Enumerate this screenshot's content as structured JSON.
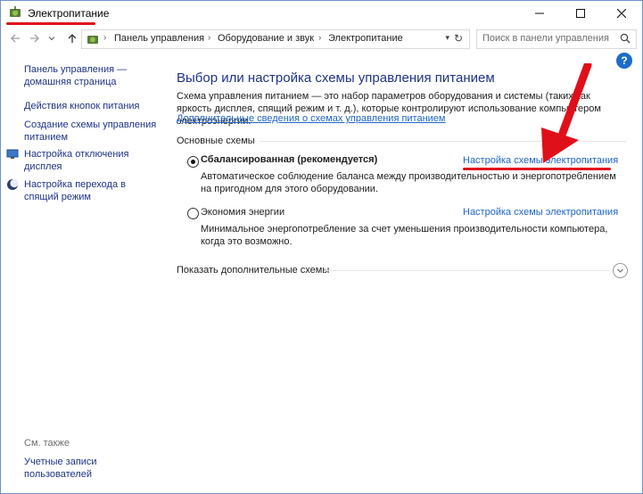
{
  "window": {
    "title": "Электропитание",
    "icon": "power-options-icon",
    "controls": {
      "minimize": "minimize-icon",
      "maximize": "maximize-icon",
      "close": "close-icon"
    }
  },
  "nav": {
    "back": "arrow-left-icon",
    "forward": "arrow-right-icon",
    "recent": "chevron-down-icon",
    "up": "arrow-up-icon",
    "breadcrumbs": [
      "Панель управления",
      "Оборудование и звук",
      "Электропитание"
    ],
    "search_placeholder": "Поиск в панели управления"
  },
  "sidebar": {
    "home": "Панель управления —\nдомашняя страница",
    "items": [
      {
        "label": "Действия кнопок питания",
        "icon": ""
      },
      {
        "label": "Создание схемы управления\nпитанием",
        "icon": ""
      },
      {
        "label": "Настройка отключения\nдисплея",
        "icon": "display-icon"
      },
      {
        "label": "Настройка перехода в\nспящий режим",
        "icon": "moon-icon"
      }
    ],
    "see_also": "См. также",
    "see_also_items": [
      "Учетные записи\nпользователей"
    ]
  },
  "main": {
    "heading": "Выбор или настройка схемы управления питанием",
    "intro": "Схема управления питанием — это набор параметров оборудования и системы (таких как яркость дисплея, спящий режим и т. д.), которые контролируют использование компьютером электроэнергии.",
    "intro_link": "Дополнительные сведения о схемах управления питанием",
    "section_label": "Основные схемы",
    "plans": [
      {
        "name": "Сбалансированная (рекомендуется)",
        "selected": true,
        "link": "Настройка схемы электропитания",
        "description": "Автоматическое соблюдение баланса между производительностью и энергопотреблением на пригодном для этого оборудовании."
      },
      {
        "name": "Экономия энергии",
        "selected": false,
        "link": "Настройка схемы электропитания",
        "description": "Минимальное энергопотребление за счет уменьшения производительности компьютера, когда это возможно."
      }
    ],
    "more_plans": "Показать дополнительные схемы"
  },
  "colors": {
    "accent": "#1e3287",
    "link": "#1e64c8",
    "annotation": "#e0101a"
  }
}
